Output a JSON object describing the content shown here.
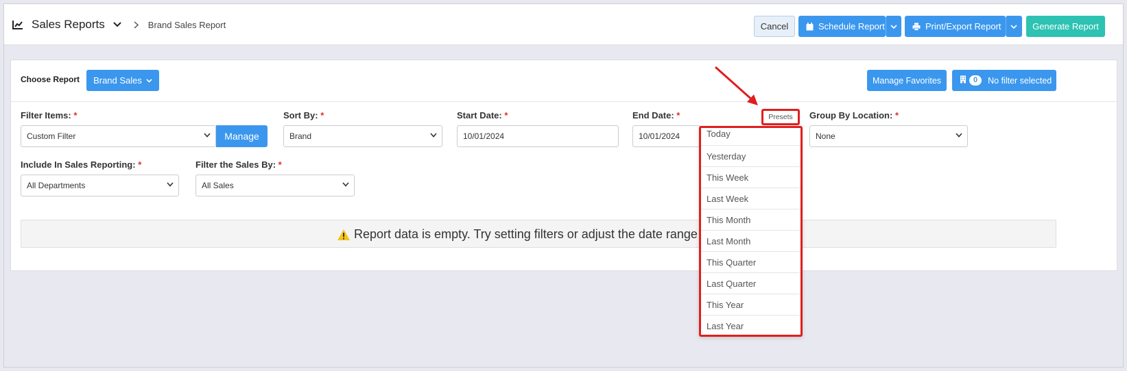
{
  "header": {
    "title": "Sales Reports",
    "breadcrumb": "Brand Sales Report",
    "buttons": {
      "cancel": "Cancel",
      "schedule": "Schedule Report",
      "print_export": "Print/Export Report",
      "generate": "Generate Report"
    }
  },
  "report_bar": {
    "choose_label": "Choose Report",
    "report_selected": "Brand Sales",
    "manage_favorites": "Manage Favorites",
    "filter_count": "0",
    "filter_status": "No filter selected"
  },
  "filters": {
    "filter_items": {
      "label": "Filter Items:",
      "value": "Custom Filter",
      "manage": "Manage"
    },
    "sort_by": {
      "label": "Sort By:",
      "value": "Brand"
    },
    "start_date": {
      "label": "Start Date:",
      "value": "10/01/2024"
    },
    "end_date": {
      "label": "End Date:",
      "value": "10/01/2024"
    },
    "group_by_location": {
      "label": "Group By Location:",
      "value": "None"
    },
    "include_in_sales": {
      "label": "Include In Sales Reporting:",
      "value": "All Departments"
    },
    "filter_sales_by": {
      "label": "Filter the Sales By:",
      "value": "All Sales"
    },
    "required_mark": "*"
  },
  "empty_message": "Report data is empty. Try setting filters or adjust the date range f",
  "presets": {
    "button_label": "Presets",
    "items": [
      "Today",
      "Yesterday",
      "This Week",
      "Last Week",
      "This Month",
      "Last Month",
      "This Quarter",
      "Last Quarter",
      "This Year",
      "Last Year"
    ]
  },
  "colors": {
    "primary": "#3b97ee",
    "generate": "#2dc2b2",
    "highlight": "#e01e1e",
    "warning": "#f5c518"
  }
}
